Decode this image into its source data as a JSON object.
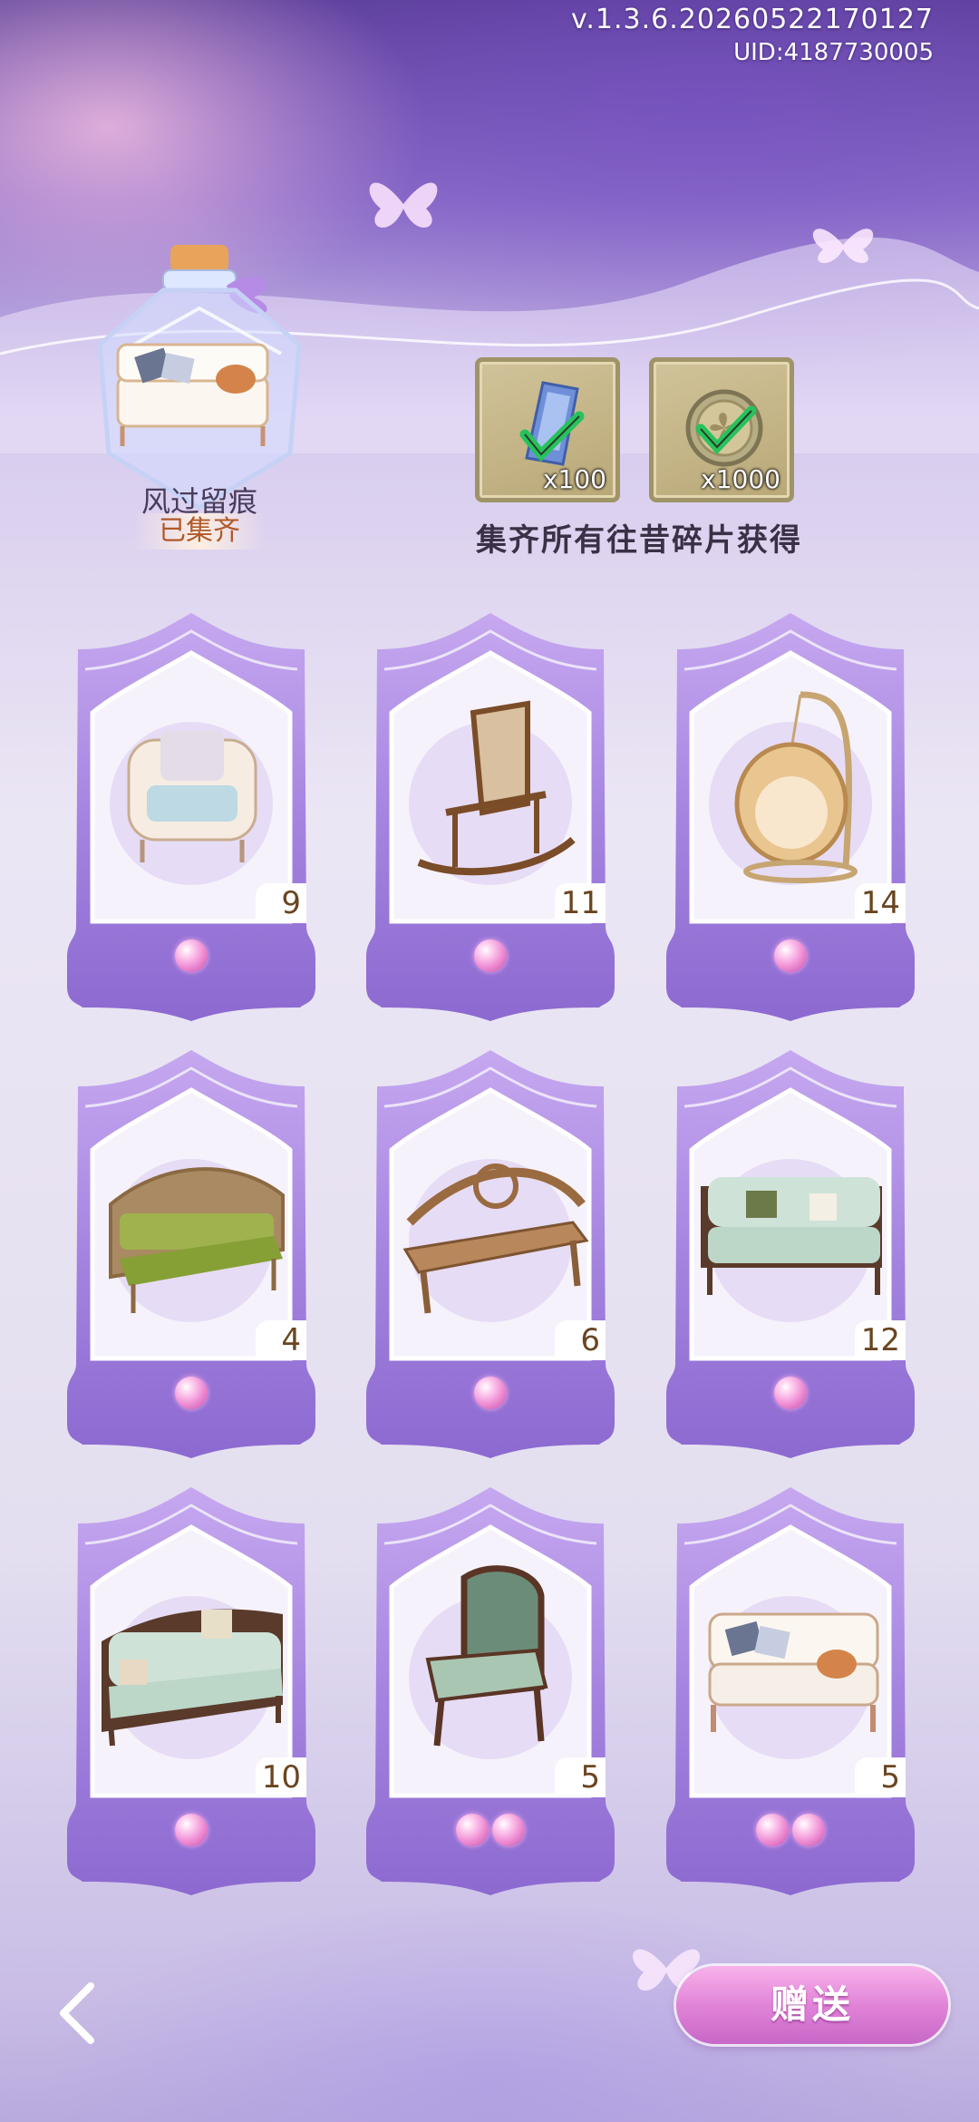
{
  "header": {
    "version": "v.1.3.6.20260522170127",
    "uid": "UID:4187730005"
  },
  "collection": {
    "name": "风过留痕",
    "status": "已集齐"
  },
  "rewards": {
    "items": [
      {
        "icon": "blue-crystal-icon",
        "qty": "x100"
      },
      {
        "icon": "clover-coin-icon",
        "qty": "x1000"
      }
    ],
    "caption": "集齐所有往昔碎片获得"
  },
  "cards": [
    {
      "item": "cushioned-armchair",
      "count": "9",
      "pearls": 1
    },
    {
      "item": "rocking-chair",
      "count": "11",
      "pearls": 1
    },
    {
      "item": "hanging-egg-chair",
      "count": "14",
      "pearls": 1
    },
    {
      "item": "green-settee",
      "count": "4",
      "pearls": 1
    },
    {
      "item": "carved-wooden-bench",
      "count": "6",
      "pearls": 1
    },
    {
      "item": "mint-carved-sofa",
      "count": "12",
      "pearls": 1
    },
    {
      "item": "mint-carved-sofa-cushions",
      "count": "10",
      "pearls": 1
    },
    {
      "item": "carved-armchair",
      "count": "5",
      "pearls": 2
    },
    {
      "item": "white-wicker-sofa",
      "count": "5",
      "pearls": 2
    }
  ],
  "footer": {
    "gift_label": "赠送"
  },
  "colors": {
    "card_purple": "#9a79d6",
    "pearl_pink": "#f08fd5",
    "gift_button": "#e184d8"
  }
}
